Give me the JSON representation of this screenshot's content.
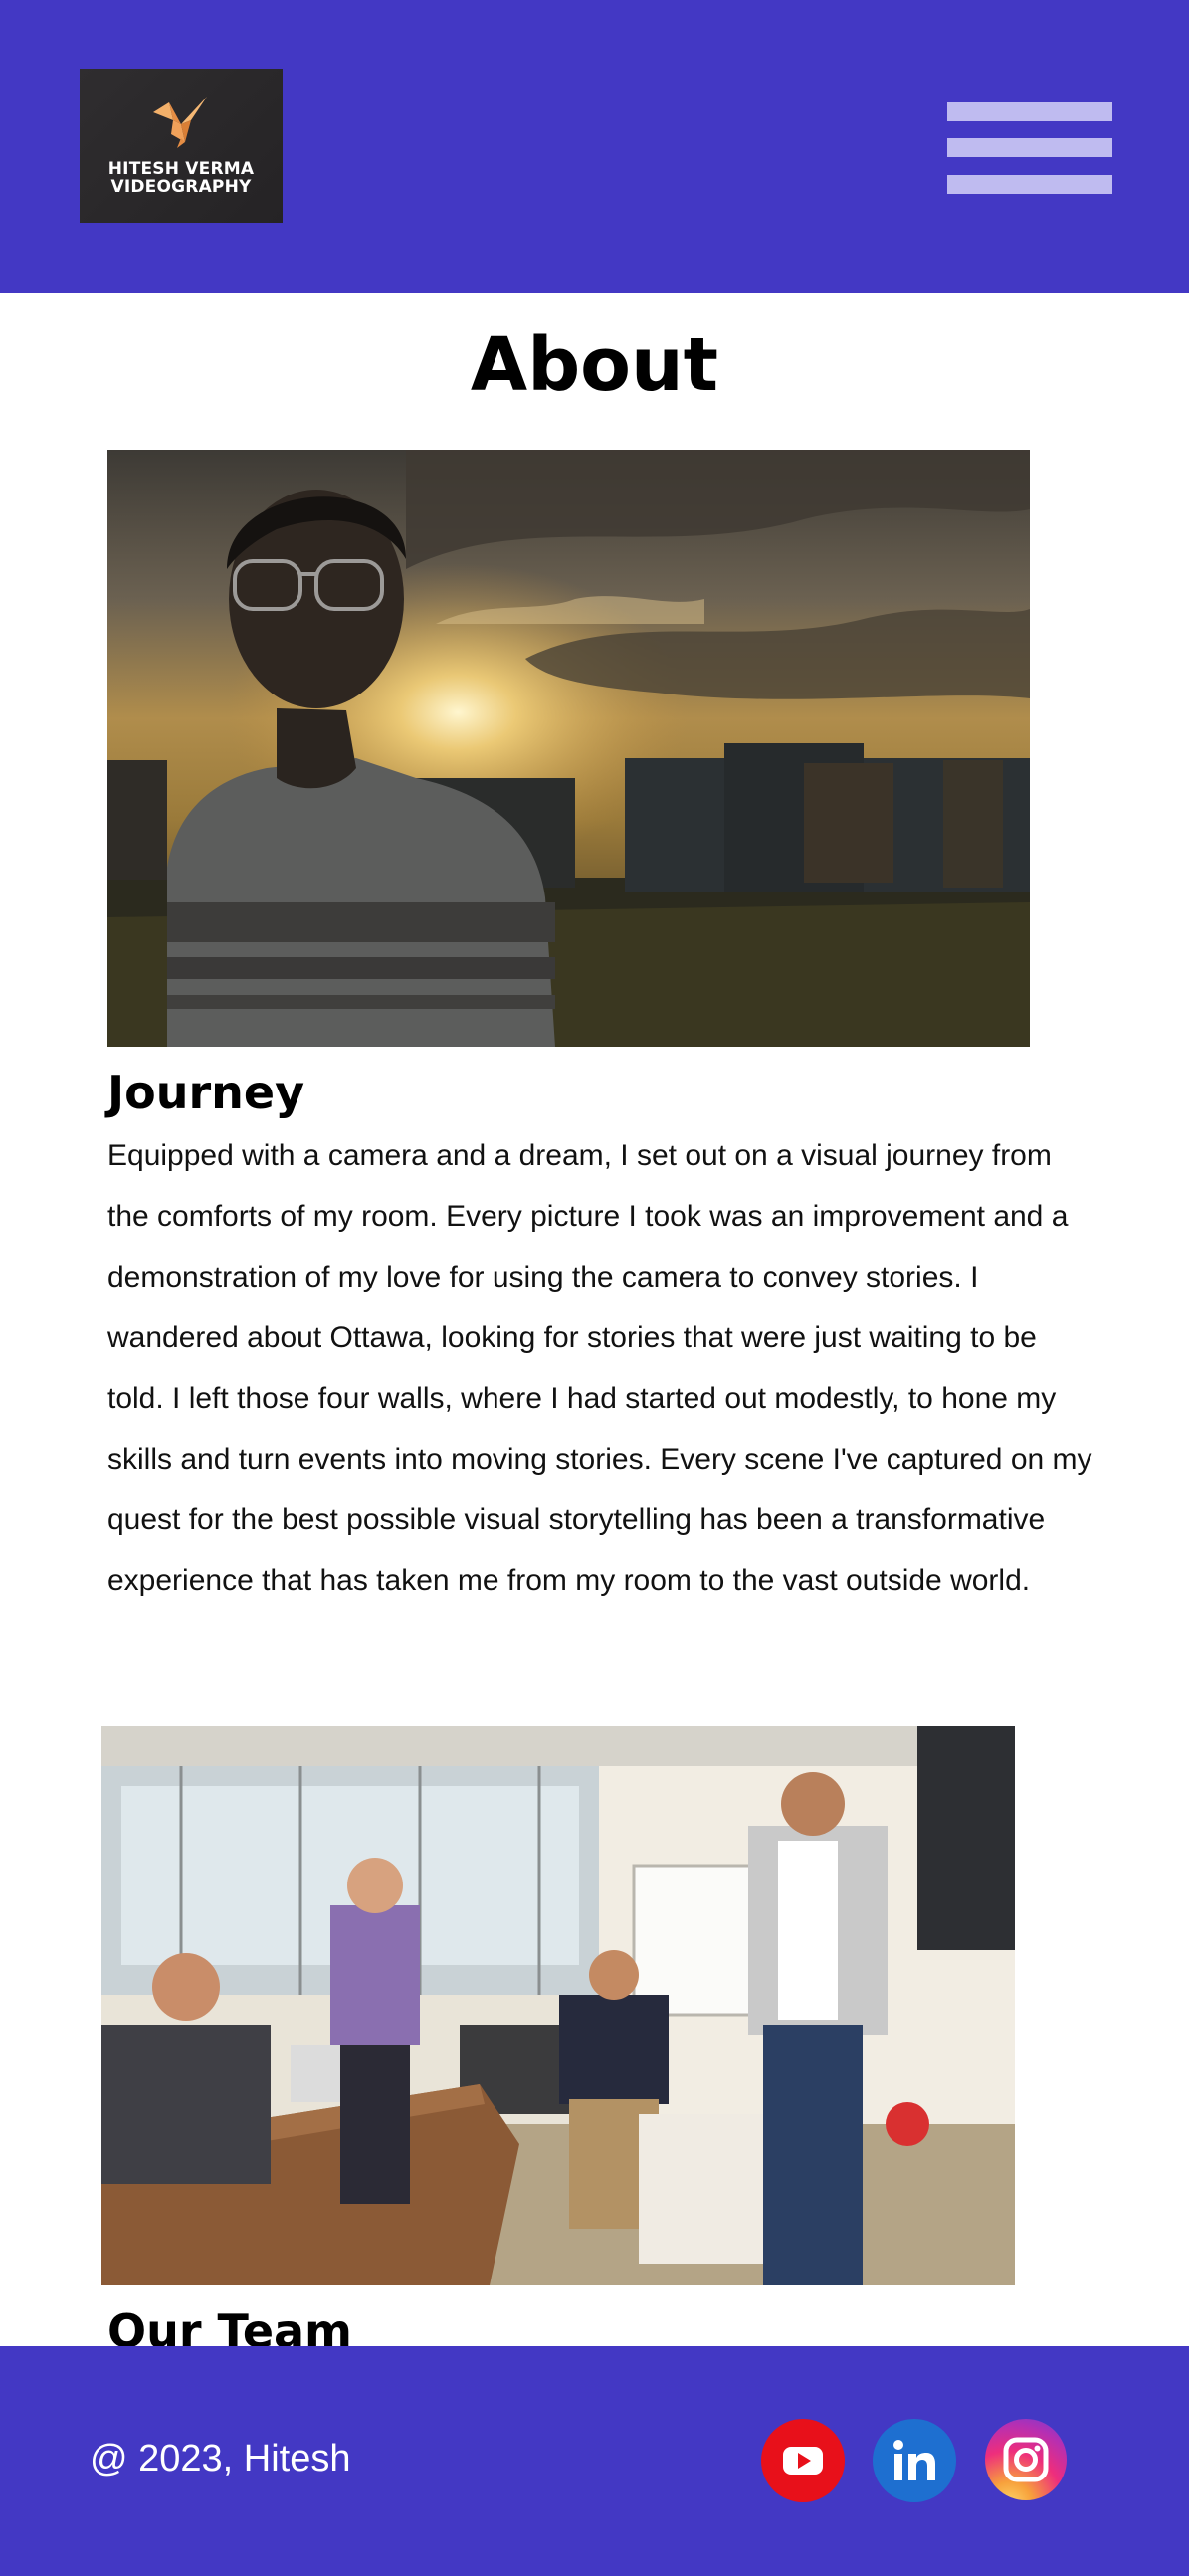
{
  "header": {
    "logo": {
      "line1": "HITESH VERMA",
      "line2": "VIDEOGRAPHY",
      "icon": "origami-bird-icon",
      "icon_color": "#f0a15a"
    },
    "menu_icon": "hamburger-menu-icon",
    "background": "#4338c4"
  },
  "page": {
    "title": "About"
  },
  "sections": [
    {
      "heading": "Journey",
      "body": "Equipped with a camera and a dream, I set out on a visual journey from the comforts of my room. Every picture I took was an improvement and a demonstration of my love for using the camera to convey stories. I wandered about Ottawa, looking for stories that were just waiting to be told. I left those four walls, where I had started out modestly, to hone my skills and turn events into moving stories. Every scene I've captured on my quest for the best possible visual storytelling has been a transformative experience that has taken me from my room to the vast outside world.",
      "image": "portrait-sunset-photo"
    },
    {
      "heading": "Our Team",
      "image": "team-meeting-photo"
    }
  ],
  "footer": {
    "copyright": "@ 2023, Hitesh",
    "social": [
      {
        "name": "YouTube",
        "icon": "youtube-icon",
        "color": "#e8101a"
      },
      {
        "name": "LinkedIn",
        "icon": "linkedin-icon",
        "color": "#1e6fd0"
      },
      {
        "name": "Instagram",
        "icon": "instagram-icon",
        "color": "#ee2e7c"
      }
    ]
  }
}
